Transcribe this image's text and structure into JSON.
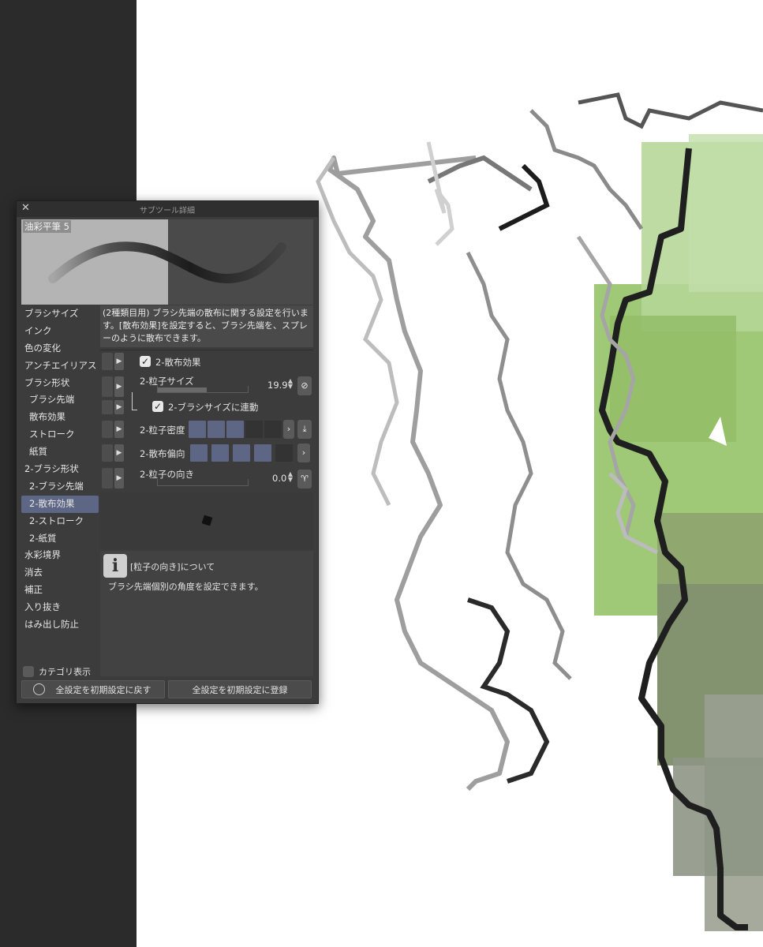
{
  "panel": {
    "title": "サブツール詳細",
    "close_icon": "close-icon",
    "brush_name": "油彩平筆 5"
  },
  "categories": [
    {
      "label": "ブラシサイズ",
      "selected": false
    },
    {
      "label": "インク",
      "selected": false
    },
    {
      "label": "色の変化",
      "selected": false
    },
    {
      "label": "アンチエイリアス",
      "selected": false
    },
    {
      "label": "ブラシ形状",
      "selected": false
    },
    {
      "label": "ブラシ先端",
      "selected": false
    },
    {
      "label": "散布効果",
      "selected": false
    },
    {
      "label": "ストローク",
      "selected": false
    },
    {
      "label": "紙質",
      "selected": false
    },
    {
      "label": "2-ブラシ形状",
      "selected": false
    },
    {
      "label": "2-ブラシ先端",
      "selected": false
    },
    {
      "label": "2-散布効果",
      "selected": true
    },
    {
      "label": "2-ストローク",
      "selected": false
    },
    {
      "label": "2-紙質",
      "selected": false
    },
    {
      "label": "水彩境界",
      "selected": false
    },
    {
      "label": "消去",
      "selected": false
    },
    {
      "label": "補正",
      "selected": false
    },
    {
      "label": "入り抜き",
      "selected": false
    },
    {
      "label": "はみ出し防止",
      "selected": false
    }
  ],
  "category_display": {
    "label": "カテゴリ表示",
    "checked": false
  },
  "description": "(2種類目用) ブラシ先端の散布に関する設定を行います。[散布効果]を設定すると、ブラシ先端を、スプレーのように散布できます。",
  "settings": {
    "scatter_effect": {
      "label": "2-散布効果",
      "checked": true
    },
    "particle_size": {
      "label": "2-粒子サイズ",
      "value": "19.9",
      "fill_fraction": 0.55
    },
    "link_brush_size": {
      "label": "2-ブラシサイズに連動",
      "checked": true
    },
    "particle_density": {
      "label": "2-粒子密度",
      "level": 3,
      "max": 5
    },
    "scatter_bias": {
      "label": "2-散布偏向",
      "level": 4,
      "max": 5
    },
    "particle_direction": {
      "label": "2-粒子の向き",
      "value": "0.0",
      "fill_fraction": 0.0
    }
  },
  "info": {
    "heading": "[粒子の向き]について",
    "body": "ブラシ先端個別の角度を設定できます。"
  },
  "buttons": {
    "reset": "全設定を初期設定に戻す",
    "register": "全設定を初期設定に登録"
  }
}
